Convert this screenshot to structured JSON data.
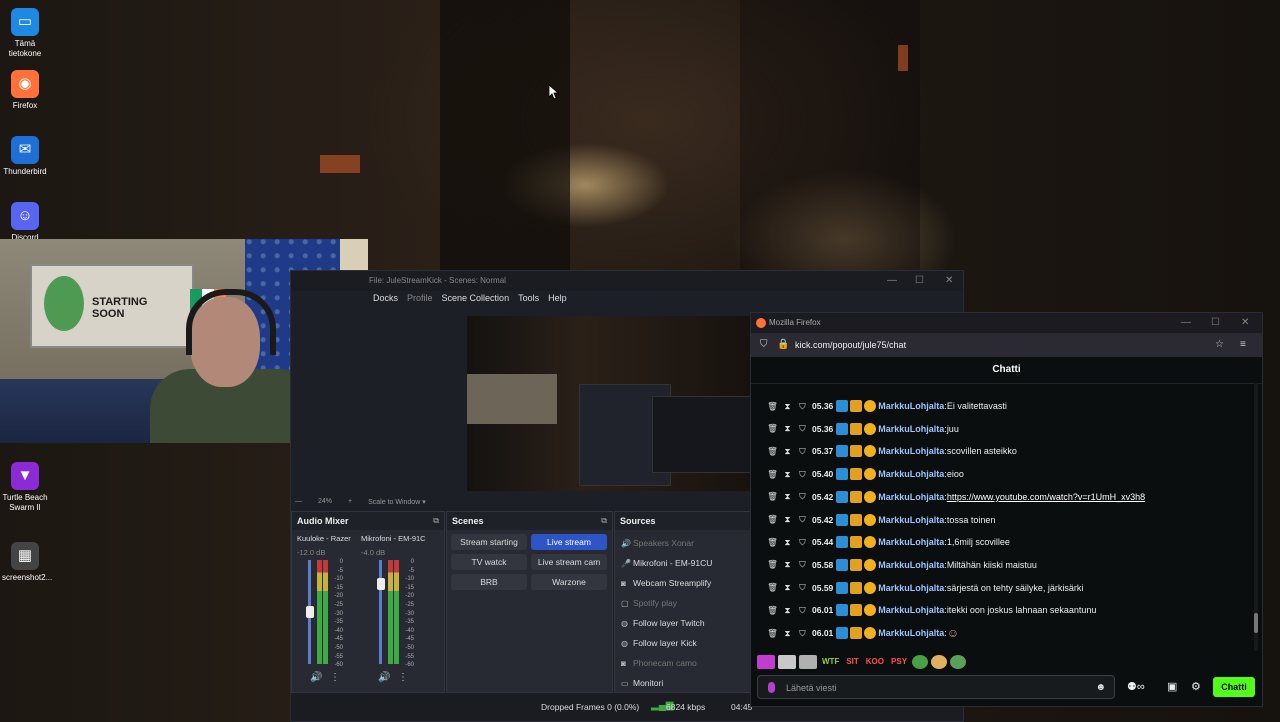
{
  "desktop": {
    "icons": [
      {
        "label": "Tämä tietokone",
        "icon": "monitor-icon",
        "color": "#1e88e5"
      },
      {
        "label": "Firefox",
        "icon": "firefox-icon",
        "color": "#ff7139"
      },
      {
        "label": "Thunderbird",
        "icon": "thunderbird-icon",
        "color": "#1f6fd6"
      },
      {
        "label": "Discord",
        "icon": "discord-icon",
        "color": "#5865f2"
      },
      {
        "label": "Turtle Beach Swarm II",
        "icon": "turtle-beach-icon",
        "color": "#8a2bd6"
      },
      {
        "label": "screenshot2...",
        "icon": "image-file-icon",
        "color": "#444444"
      }
    ]
  },
  "webcam": {
    "poster_text": "STARTING SOON"
  },
  "obs": {
    "title": "File: JuleStreamKick - Scenes: Normal",
    "menu": [
      "Docks",
      "Profile",
      "Scene Collection",
      "Tools",
      "Help"
    ],
    "zoom": "24%",
    "scale_label": "Scale to Window",
    "audio_mixer": {
      "title": "Audio Mixer",
      "channels": [
        {
          "name": "Kuuloke - Razer",
          "db": "-12.0 dB"
        },
        {
          "name": "Mikrofoni - EM-91C",
          "db": "-4.0 dB"
        }
      ],
      "scale": [
        "0",
        "-5",
        "-10",
        "-15",
        "-20",
        "-25",
        "-30",
        "-35",
        "-40",
        "-45",
        "-50",
        "-55",
        "-60"
      ]
    },
    "scenes": {
      "title": "Scenes",
      "items": [
        "Stream starting",
        "Live stream",
        "TV watck",
        "Live stream cam",
        "BRB",
        "Warzone"
      ],
      "selected": "Live stream"
    },
    "sources": {
      "title": "Sources",
      "items": [
        {
          "label": "Speakers Xonar",
          "icon": "speaker-icon",
          "dim": true
        },
        {
          "label": "Mikrofoni - EM-91CU",
          "icon": "mic-icon",
          "dim": false
        },
        {
          "label": "Webcam Streamplify",
          "icon": "camera-icon",
          "dim": false
        },
        {
          "label": "Spotify play",
          "icon": "window-icon",
          "dim": true
        },
        {
          "label": "Follow layer Twitch",
          "icon": "globe-icon",
          "dim": false
        },
        {
          "label": "Follow layer Kick",
          "icon": "globe-icon",
          "dim": false
        },
        {
          "label": "Phonecam camo",
          "icon": "camera-icon",
          "dim": true
        },
        {
          "label": "Monitori",
          "icon": "monitor-icon",
          "dim": false
        }
      ]
    },
    "status": {
      "dropped": "Dropped Frames 0 (0.0%)",
      "bitrate": "6824 kbps",
      "time": "04:45"
    }
  },
  "firefox": {
    "title": "Mozilla Firefox",
    "url": "kick.com/popout/jule75/chat",
    "chat": {
      "header": "Chatti",
      "username": "MarkkuLohjalta",
      "messages": [
        {
          "time": "05.36",
          "text": "Ei valitettavasti",
          "link": false
        },
        {
          "time": "05.36",
          "text": "juu",
          "link": false
        },
        {
          "time": "05.37",
          "text": "scovillen asteikko",
          "link": false
        },
        {
          "time": "05.40",
          "text": "eioo",
          "link": false
        },
        {
          "time": "05.42",
          "text": "https://www.youtube.com/watch?v=r1UmH_xv3h8",
          "link": true
        },
        {
          "time": "05.42",
          "text": "tossa toinen",
          "link": false
        },
        {
          "time": "05.44",
          "text": "1,6milj scovillee",
          "link": false
        },
        {
          "time": "05.58",
          "text": "Miltähän kiiski maistuu",
          "link": false
        },
        {
          "time": "05.59",
          "text": "särjestä on tehty säilyke, järkisärki",
          "link": false
        },
        {
          "time": "06.01",
          "text": "itekki oon joskus lahnaan sekaantunu",
          "link": false
        },
        {
          "time": "06.01",
          "text": "",
          "link": false
        }
      ],
      "input_placeholder": "Lähetä viesti",
      "send_label": "Chatti",
      "emotes": [
        "WTF",
        "SIT",
        "KOO",
        "PSY"
      ]
    }
  }
}
